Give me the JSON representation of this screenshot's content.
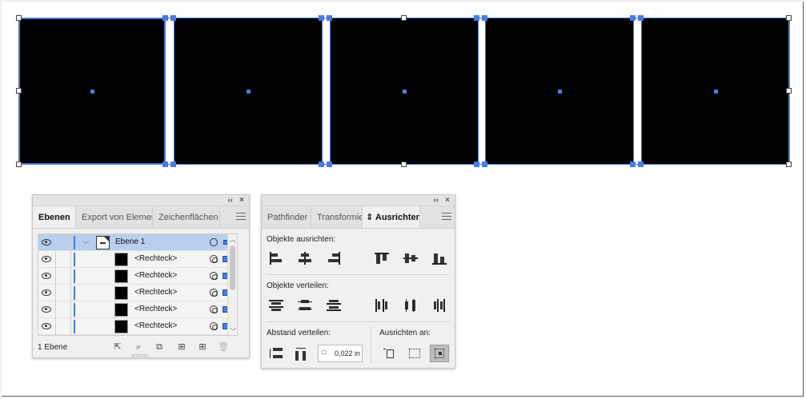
{
  "artboard": {
    "rectangles": 5,
    "accent_color": "#4a7be0"
  },
  "layers_panel": {
    "title_controls": [
      "‹‹",
      "×"
    ],
    "tabs": [
      {
        "label": "Ebenen",
        "active": true
      },
      {
        "label": "Export von Elementen",
        "active": false
      },
      {
        "label": "Zeichenflächen",
        "active": false
      }
    ],
    "rows": [
      {
        "label": "Ebene 1",
        "type": "layer"
      },
      {
        "label": "<Rechteck>",
        "type": "object"
      },
      {
        "label": "<Rechteck>",
        "type": "object"
      },
      {
        "label": "<Rechteck>",
        "type": "object"
      },
      {
        "label": "<Rechteck>",
        "type": "object"
      },
      {
        "label": "<Rechteck>",
        "type": "object"
      }
    ],
    "footer_label": "1 Ebene",
    "footer_icons": [
      "export-icon",
      "search-icon",
      "clipping-mask-icon",
      "new-sublayer-icon",
      "new-layer-icon",
      "trash-icon"
    ]
  },
  "align_panel": {
    "title_controls": [
      "‹‹",
      "×"
    ],
    "tabs": [
      {
        "label": "Pathfinder",
        "active": false
      },
      {
        "label": "Transformieren",
        "active": false
      },
      {
        "label": "Ausrichten",
        "active": true
      }
    ],
    "tab_arrow": "⇕",
    "align_objects_label": "Objekte ausrichten:",
    "distribute_objects_label": "Objekte verteilen:",
    "distribute_spacing_label": "Abstand verteilen:",
    "align_to_label": "Ausrichten an:",
    "spacing_value": "0,022 in"
  }
}
